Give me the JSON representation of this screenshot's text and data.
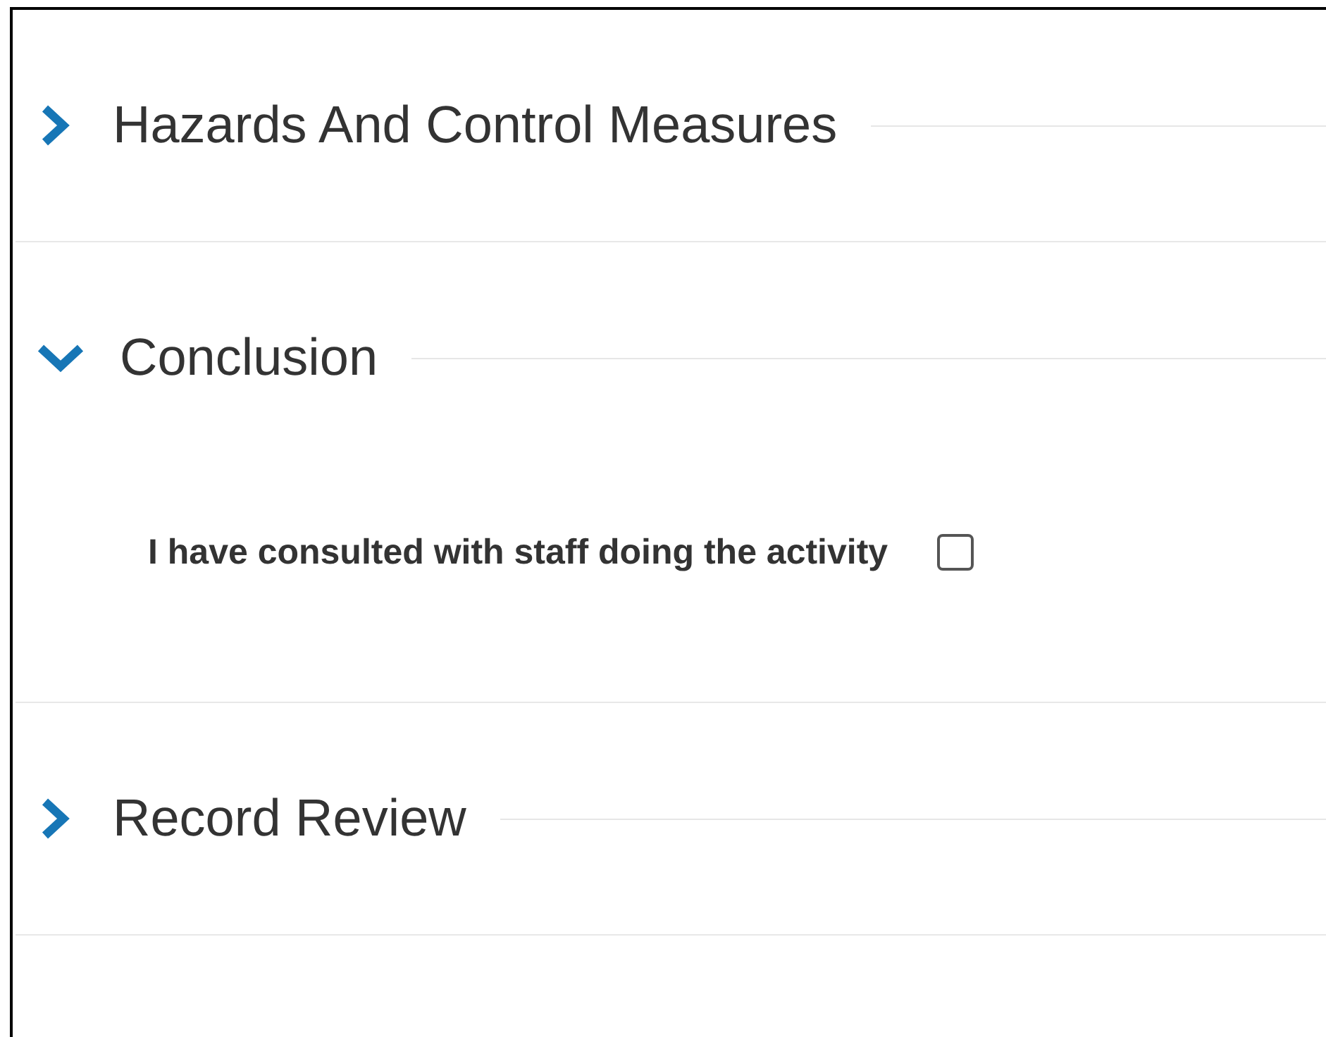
{
  "sections": [
    {
      "title": "Hazards And Control Measures",
      "expanded": false
    },
    {
      "title": "Conclusion",
      "expanded": true,
      "fields": [
        {
          "label": "I have consulted with staff doing the activity",
          "checked": false
        }
      ]
    },
    {
      "title": "Record Review",
      "expanded": false
    }
  ]
}
